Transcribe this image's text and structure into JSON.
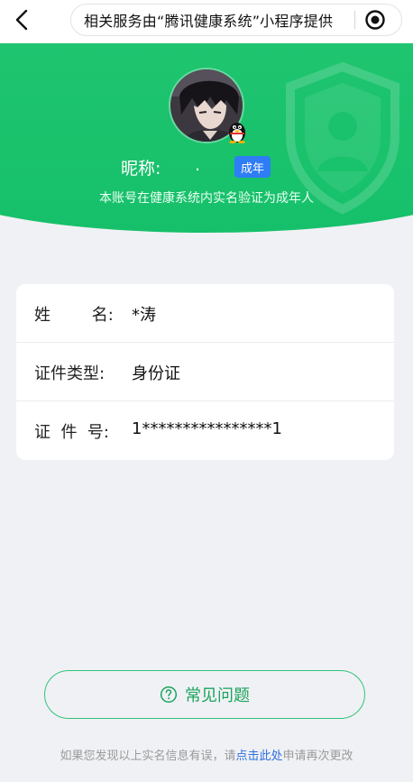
{
  "navbar": {
    "url_text": "相关服务由“腾讯健康系统”小程序提供"
  },
  "profile": {
    "nickname_label": "昵称:",
    "nickname_value": ".",
    "adult_badge": "成年",
    "verify_note": "本账号在健康系统内实名验证为成年人"
  },
  "info": {
    "rows": [
      {
        "label": "姓        名:",
        "value": "*涛"
      },
      {
        "label": "证件类型:",
        "value": "身份证"
      },
      {
        "label": "证  件  号:",
        "value": "1****************1"
      }
    ]
  },
  "faq": {
    "label": "常见问题"
  },
  "footer": {
    "prefix": "如果您发现以上实名信息有误，请",
    "link": "点击此处",
    "suffix": "申请再次更改"
  },
  "colors": {
    "brand_green": "#16c06a",
    "badge_blue": "#2f7df6",
    "link_blue": "#2d6fe0"
  },
  "icons": {
    "back": "chevron-left-icon",
    "target": "target-icon",
    "qq": "qq-penguin-icon",
    "faq": "question-circle-icon",
    "watermark": "shield-user-icon"
  }
}
